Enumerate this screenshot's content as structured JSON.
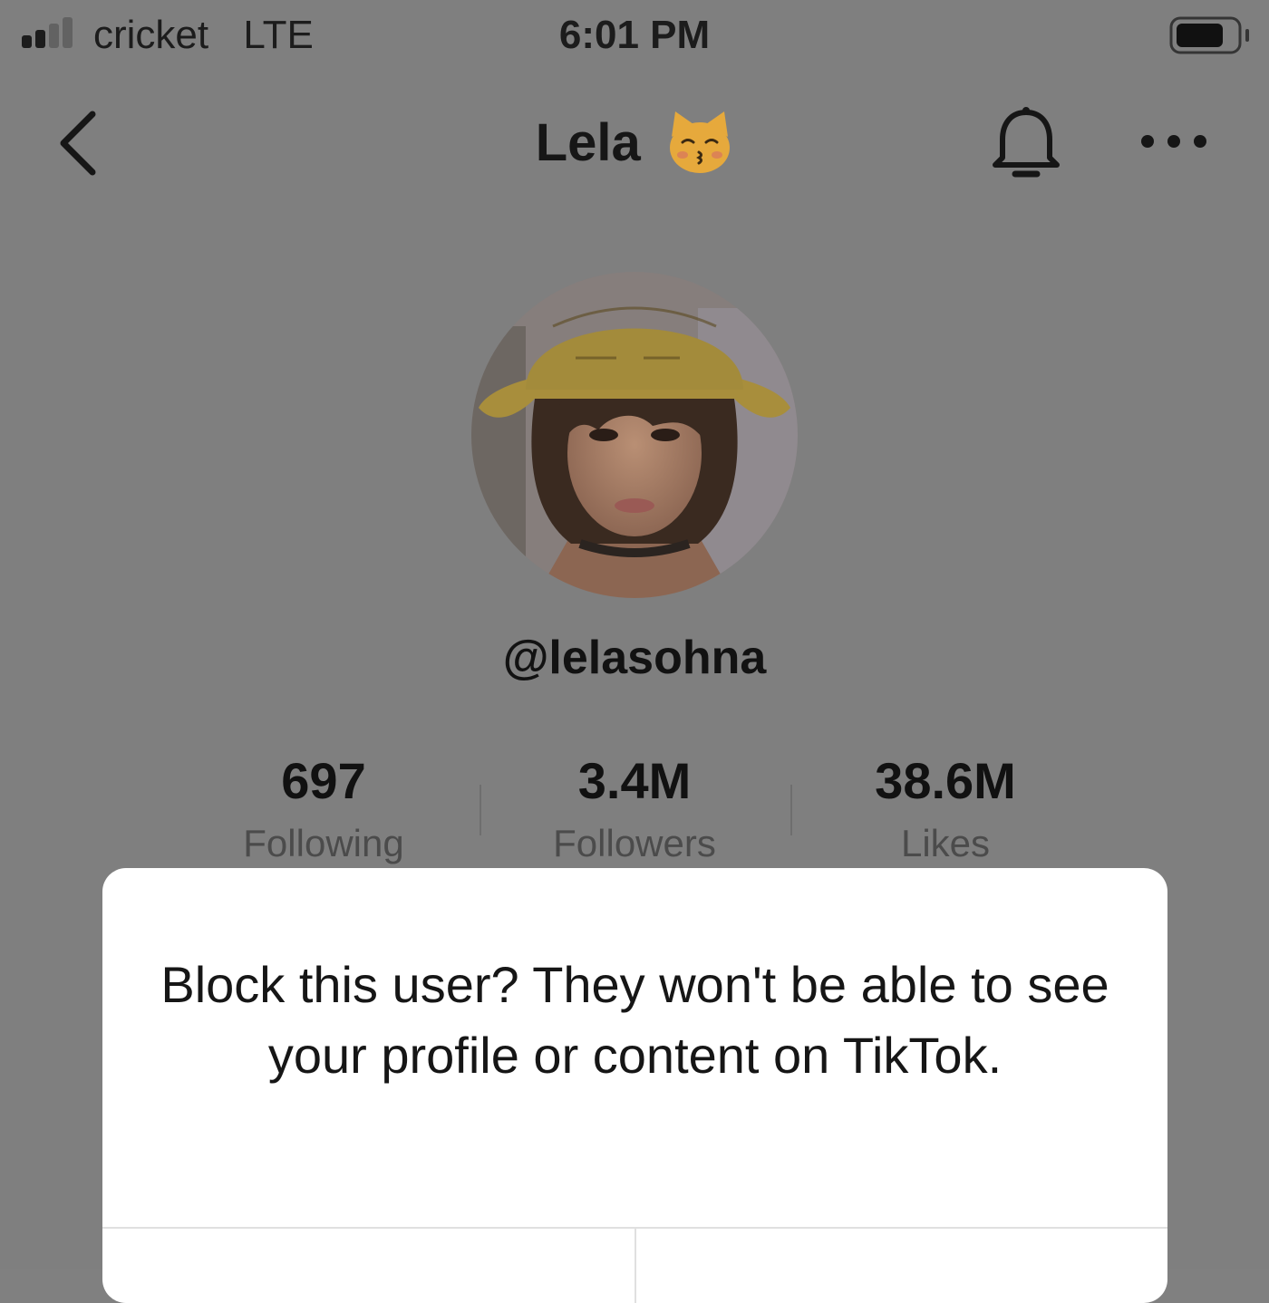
{
  "status_bar": {
    "carrier": "cricket",
    "network": "LTE",
    "time": "6:01 PM",
    "signal_bars_active": 2,
    "signal_bars_total": 4,
    "battery_level": 0.8
  },
  "header": {
    "title": "Lela",
    "title_emoji_icon": "kissing-cat-face-icon",
    "back_icon": "chevron-left-icon",
    "notification_icon": "bell-icon",
    "more_icon": "more-horizontal-icon"
  },
  "profile": {
    "avatar_icon": "profile-photo",
    "username": "@lelasohna",
    "stats": [
      {
        "value": "697",
        "label": "Following"
      },
      {
        "value": "3.4M",
        "label": "Followers"
      },
      {
        "value": "38.6M",
        "label": "Likes"
      }
    ]
  },
  "dialog": {
    "message": "Block this user? They won't be able to see your profile or content on TikTok.",
    "cancel_label": "",
    "block_label": ""
  },
  "colors": {
    "overlay_background": "#7f7f7f",
    "dialog_background": "#ffffff",
    "primary_text": "#161616",
    "secondary_text": "#4b4b4b",
    "hat_yellow": "#f2c94c",
    "danger_accent": "#fe2c55"
  }
}
